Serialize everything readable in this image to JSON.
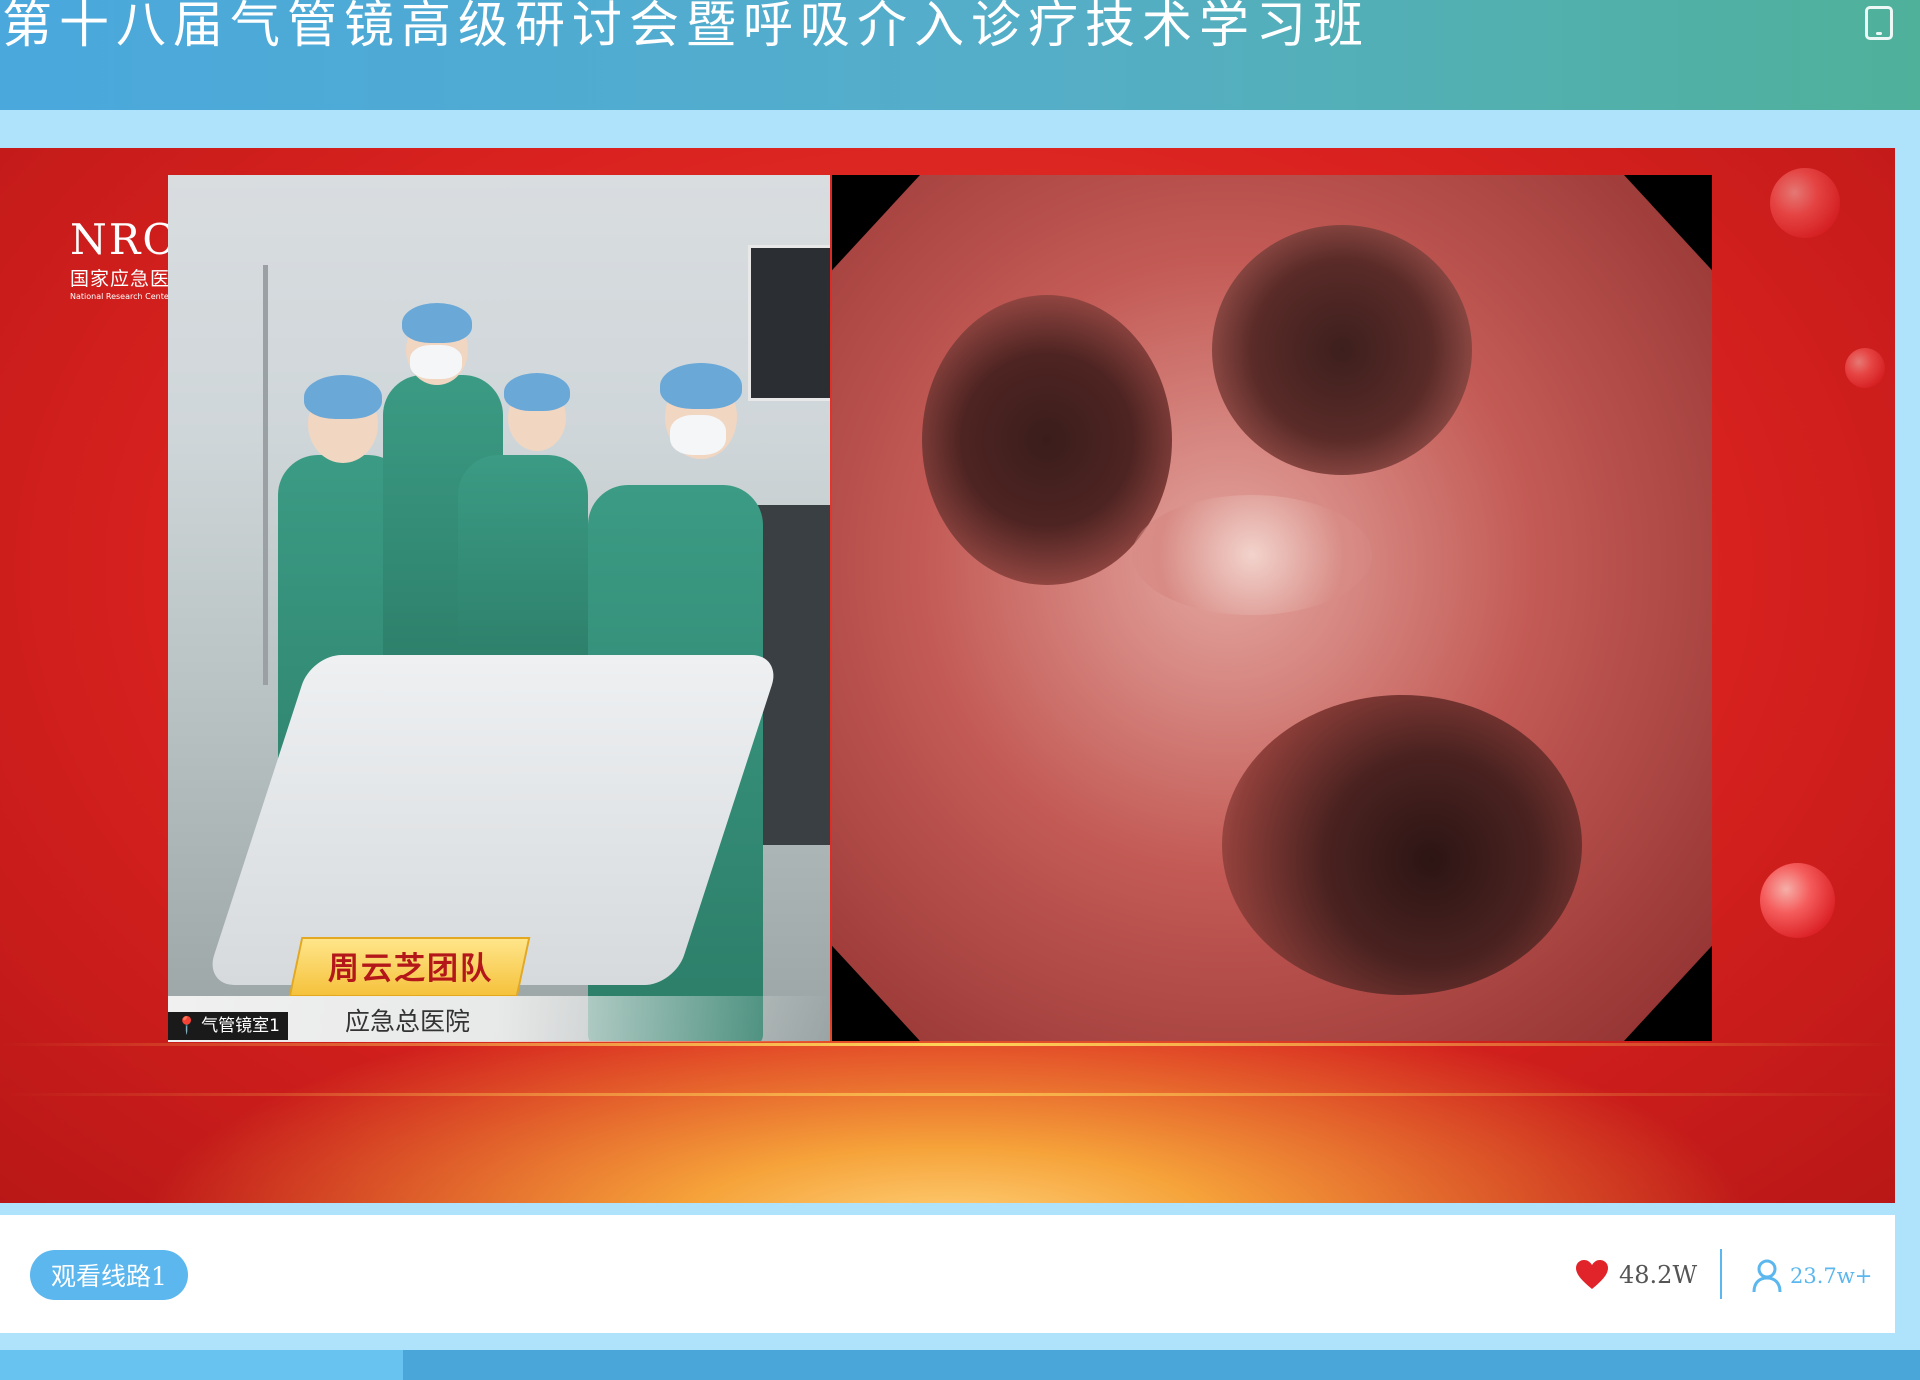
{
  "header": {
    "title": "第十八届气管镜高级研讨会暨呼吸介入诊疗技术学习班",
    "device_icon": "phone-icon"
  },
  "stage": {
    "logos": {
      "nrcem_abbr": "NRCEM",
      "nrcem_cn": "国家应急医学研究中心",
      "nrcem_en": "National Research Center for Emergency Medicine"
    },
    "overlay": {
      "team_name": "周云芝团队",
      "hospital": "应急总医院",
      "room_tag": "气管镜室1"
    }
  },
  "bottom": {
    "route_button": "观看线路1",
    "likes": "48.2W",
    "viewers": "23.7w+"
  },
  "progress": {
    "fraction": 0.21
  },
  "colors": {
    "header_start": "#4aa8dd",
    "header_end": "#4fb19a",
    "accent_blue": "#5bb7ee",
    "stage_red": "#d9221f",
    "heart_red": "#e0242a"
  }
}
